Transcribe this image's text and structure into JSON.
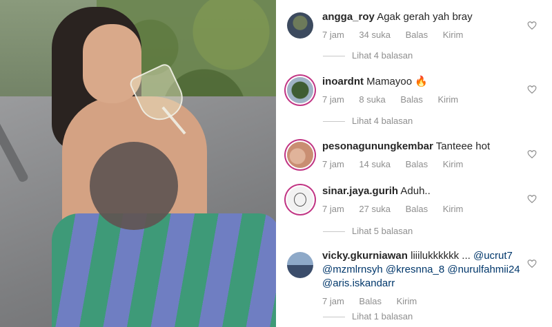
{
  "comments": [
    {
      "username": "angga_roy",
      "text": "Agak gerah yah bray",
      "time": "7 jam",
      "likes": "34 suka",
      "reply": "Balas",
      "send": "Kirim",
      "view_replies": "Lihat 4 balasan"
    },
    {
      "username": "inoardnt",
      "text": "Mamayoo 🔥",
      "time": "7 jam",
      "likes": "8 suka",
      "reply": "Balas",
      "send": "Kirim",
      "view_replies": "Lihat 4 balasan"
    },
    {
      "username": "pesonagunungkembar",
      "text": "Tanteee hot",
      "time": "7 jam",
      "likes": "14 suka",
      "reply": "Balas",
      "send": "Kirim"
    },
    {
      "username": "sinar.jaya.gurih",
      "text": "Aduh..",
      "time": "7 jam",
      "likes": "27 suka",
      "reply": "Balas",
      "send": "Kirim",
      "view_replies": "Lihat 5 balasan"
    },
    {
      "username": "vicky.gkurniawan",
      "text": "liiilukkkkkk ...",
      "mentions_line1": "@ucrut7",
      "mentions_line2": [
        "@mzmlrnsyh",
        "@kresnna_8",
        "@nurulfahmii24"
      ],
      "mentions_line3": "@aris.iskandarr",
      "time": "7 jam",
      "reply": "Balas",
      "send": "Kirim",
      "view_replies": "Lihat 1 balasan"
    }
  ],
  "icons": {
    "like": "heart-icon",
    "avatar_doodle": "smiley-doodle-icon"
  },
  "colors": {
    "story_ring": "#c13584",
    "mention": "#00376b",
    "meta": "#8e8e8e"
  }
}
